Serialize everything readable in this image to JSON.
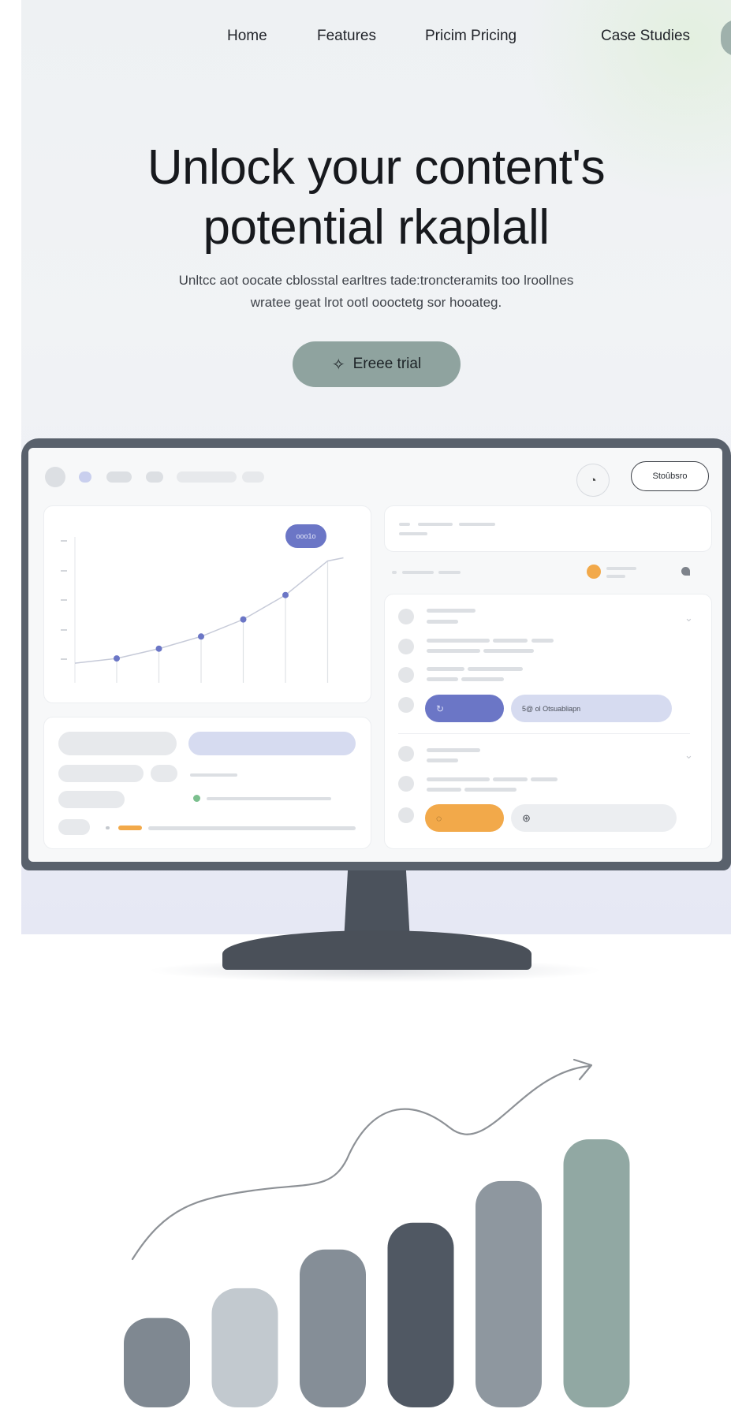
{
  "nav": {
    "items": [
      "Home",
      "Features",
      "Pricim Pricing",
      "Case Studies"
    ]
  },
  "hero": {
    "title_line1": "Unlock your content's",
    "title_line2": "potential rkaplall",
    "subtitle_line1": "Unltcc aot oocate cblosstal earltres tade:troncteramits too lroollnes",
    "subtitle_line2": "wratee geat lrot ootl oooctetg sor hooateg.",
    "cta_label": "Ereee trial",
    "cta_icon": "sparkle-icon"
  },
  "dashboard": {
    "top_button_label": "Stoûbsro",
    "bell_icon": "bell-icon",
    "chart_tooltip": "ooo1o",
    "row_button_label": "5@ ol Otsuabliapn",
    "accent_colors": {
      "indigo": "#6b76c6",
      "orange": "#f2a94a",
      "green": "#7bbf8e",
      "lavender": "#d6dbf0"
    },
    "line_chart": {
      "type": "line",
      "points": [
        1,
        2,
        3,
        4,
        5,
        6
      ],
      "values": [
        10,
        14,
        19,
        26,
        36,
        50
      ]
    }
  },
  "chart_data": {
    "type": "bar",
    "values": [
      30,
      40,
      53,
      62,
      76,
      90
    ],
    "colors": [
      "#7f8891",
      "#c2c9cf",
      "#858e97",
      "#505863",
      "#8e979f",
      "#91a8a3"
    ],
    "trend_arrow": true
  }
}
